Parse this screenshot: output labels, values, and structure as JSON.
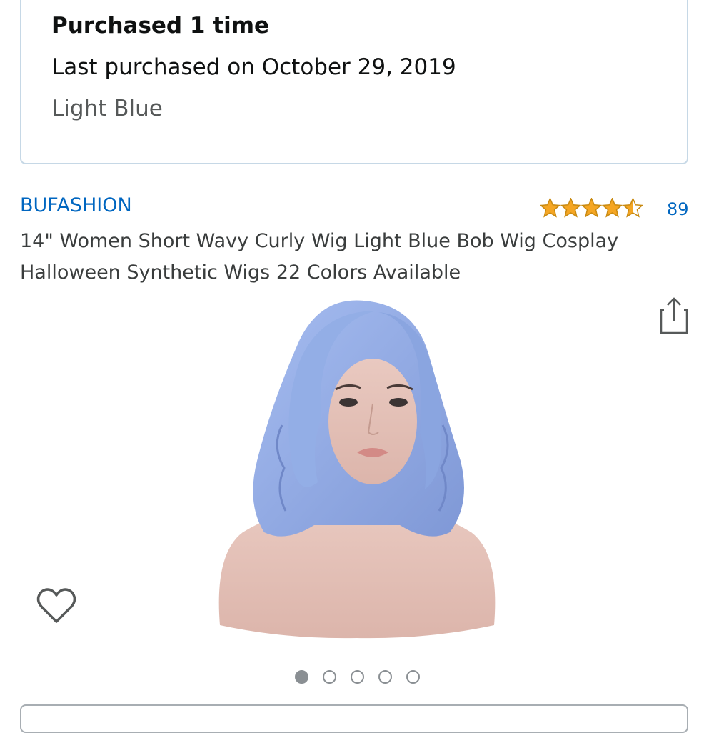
{
  "purchase_info": {
    "purchased_count": "Purchased 1 time",
    "last_purchased": "Last purchased on October 29, 2019",
    "variant": "Light Blue"
  },
  "product": {
    "brand": "BUFASHION",
    "rating": 4.5,
    "review_count": "89",
    "title": "14\" Women Short Wavy Curly Wig Light Blue Bob Wig Cosplay Halloween Synthetic Wigs 22 Colors Available"
  },
  "carousel": {
    "total_images": 5,
    "current_index": 0
  },
  "icons": {
    "share": "share-icon",
    "wishlist": "heart-icon",
    "star": "star-icon"
  },
  "colors": {
    "link": "#0066c0",
    "star": "#f5a623",
    "border": "#c6d8e6",
    "wig": "#8fa8e0"
  }
}
